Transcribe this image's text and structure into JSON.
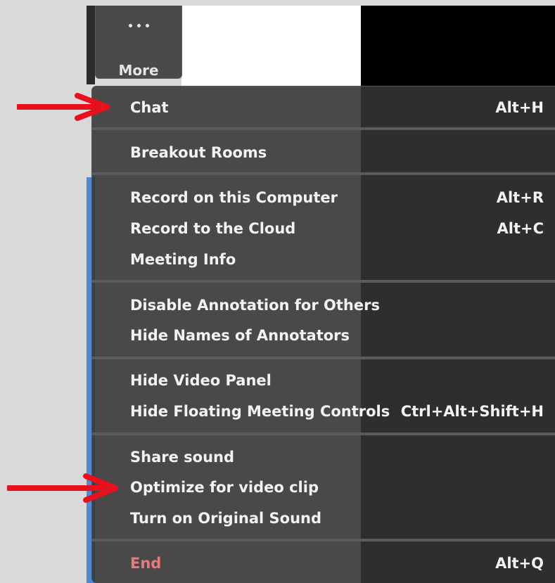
{
  "toolbar": {
    "more_label": "More",
    "more_icon": "more-dots-icon"
  },
  "menu": {
    "items": [
      {
        "label": "Chat",
        "shortcut": "Alt+H"
      },
      {
        "label": "Breakout Rooms",
        "shortcut": ""
      },
      {
        "label": "Record on this Computer",
        "shortcut": "Alt+R"
      },
      {
        "label": "Record to the Cloud",
        "shortcut": "Alt+C"
      },
      {
        "label": "Meeting Info",
        "shortcut": ""
      },
      {
        "label": "Disable Annotation for Others",
        "shortcut": ""
      },
      {
        "label": "Hide Names of Annotators",
        "shortcut": ""
      },
      {
        "label": "Hide Video Panel",
        "shortcut": ""
      },
      {
        "label": "Hide Floating Meeting Controls",
        "shortcut": "Ctrl+Alt+Shift+H"
      },
      {
        "label": "Share sound",
        "shortcut": ""
      },
      {
        "label": "Optimize for video clip",
        "shortcut": ""
      },
      {
        "label": "Turn on Original Sound",
        "shortcut": ""
      },
      {
        "label": "End",
        "shortcut": "Alt+Q"
      }
    ]
  },
  "colors": {
    "menu_background": "#343434",
    "text": "#f2f2f2",
    "end_text": "#e67a80",
    "annotation_arrow": "#e8101c",
    "accent_strip": "#4a8ad8"
  }
}
